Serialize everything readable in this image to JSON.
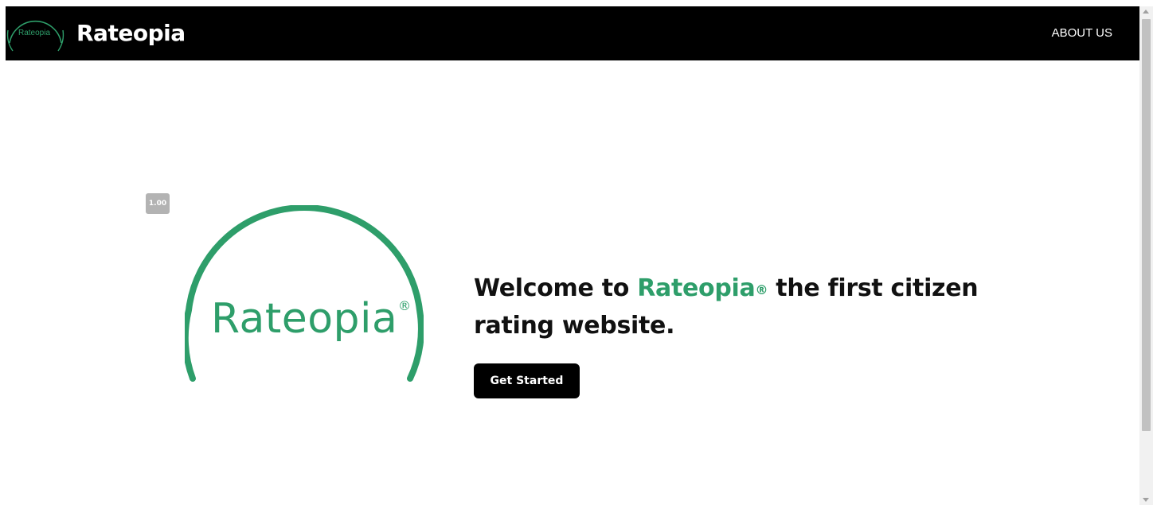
{
  "navbar": {
    "logo_text": "Rateopia",
    "brand": "Rateopia",
    "about_label": "ABOUT US"
  },
  "badge": {
    "version": "1.00"
  },
  "hero": {
    "logo_text": "Rateopia",
    "logo_mark": "®",
    "headline_prefix": "Welcome to ",
    "headline_brand": "Rateopia",
    "headline_reg": "®",
    "headline_suffix": " the first citizen rating website.",
    "cta_label": "Get Started"
  },
  "colors": {
    "brand_green": "#2e9e6a",
    "navbar_bg": "#000000",
    "button_bg": "#000000",
    "badge_bg": "#b3b3b3"
  }
}
